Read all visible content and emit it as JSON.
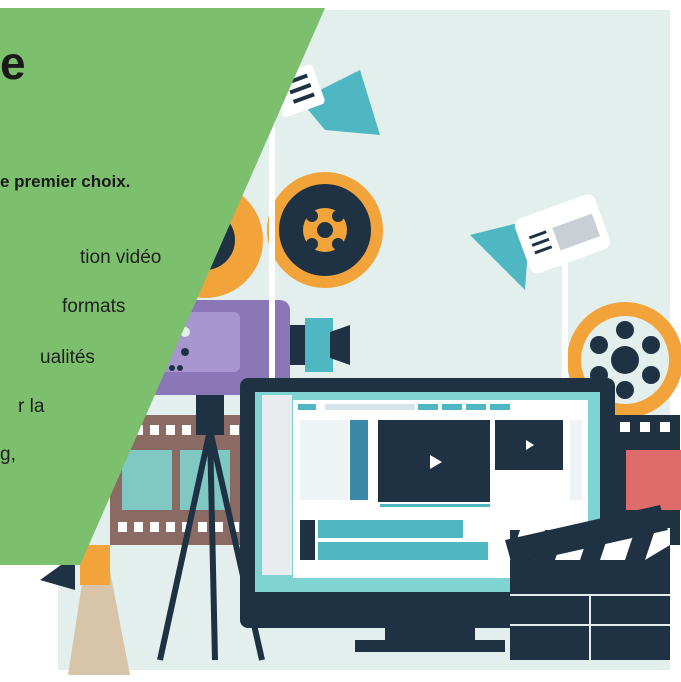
{
  "headline_fragment": "e",
  "tagline_fragment": "e premier choix.",
  "body_lines": [
    "tion   vidéo",
    "formats",
    "ualités",
    "r    la",
    "g,"
  ],
  "colors": {
    "panel_green": "#7cbf6c",
    "background": "#e3efec",
    "dark_navy": "#1f3244",
    "orange": "#f2a33a",
    "teal": "#4fb7c2",
    "purple": "#8b77b8"
  },
  "icons": [
    "studio-light-icon",
    "film-camera-icon",
    "film-reel-icon",
    "film-strip-icon",
    "monitor-icon",
    "clapperboard-icon",
    "megaphone-icon",
    "play-icon"
  ]
}
